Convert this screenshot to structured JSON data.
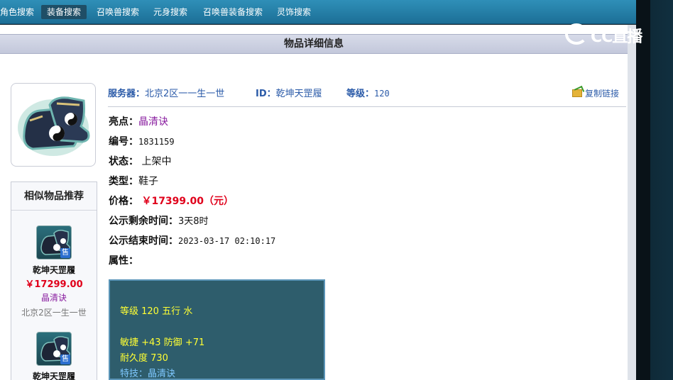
{
  "nav": {
    "items": [
      "角色搜索",
      "装备搜索",
      "召唤兽搜索",
      "元身搜索",
      "召唤兽装备搜索",
      "灵饰搜索"
    ],
    "active_index": 1
  },
  "page_title": "物品详细信息",
  "item": {
    "server_label": "服务器：",
    "server": "北京2区一一生一世",
    "id_label": "ID：",
    "id": "乾坤天罡履",
    "level_label": "等级：",
    "level": "120",
    "copy_link": "复制链接",
    "feature_label": "亮点：",
    "feature": "晶清诀",
    "number_label": "编号：",
    "number": "1831159",
    "status_label": "状态：",
    "status": "上架中",
    "type_label": "类型：",
    "type": "鞋子",
    "price_label": "价格：",
    "price": "￥17399.00（元）",
    "remaining_label": "公示剩余时间：",
    "remaining": "3天8时",
    "end_label": "公示结束时间：",
    "end": "2023-03-17 02:10:17",
    "attr_label": "属性："
  },
  "attributes": {
    "line1": "等级 120 五行 水",
    "line2": "敏捷 +43 防御 +71",
    "line3": "耐久度 730",
    "line4": "特技：晶清诀"
  },
  "similar": {
    "title": "相似物品推荐",
    "badge": "售",
    "items": [
      {
        "name": "乾坤天罡履",
        "price": "￥17299.00",
        "feature": "晶清诀",
        "server": "北京2区一生一世"
      },
      {
        "name": "乾坤天罡履"
      }
    ]
  },
  "watermark": "CC直播",
  "colors": {
    "nav_bg": "#1c6f97",
    "link_blue": "#2a5aa8",
    "price_red": "#e0001b",
    "feature_purple": "#8a1fa0",
    "attr_bg": "#2e5d6c",
    "attr_text": "#ffff33"
  }
}
